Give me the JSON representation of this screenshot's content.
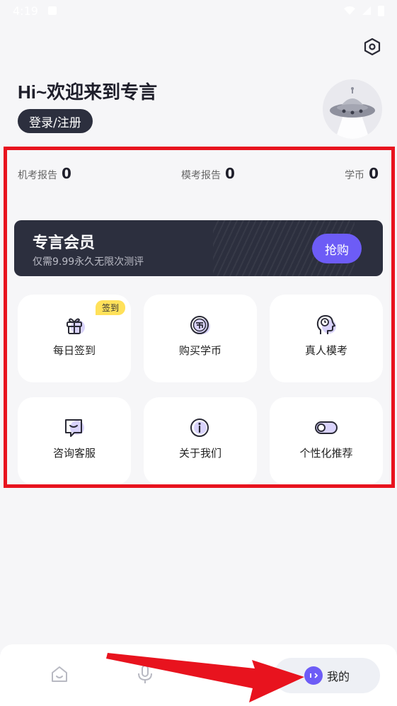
{
  "status_bar": {
    "time": "4:19"
  },
  "header": {
    "greeting": "Hi~欢迎来到专言",
    "login_label": "登录/注册"
  },
  "stats": [
    {
      "label": "机考报告",
      "value": "0"
    },
    {
      "label": "模考报告",
      "value": "0"
    },
    {
      "label": "学币",
      "value": "0"
    }
  ],
  "vip": {
    "title": "专言会员",
    "subtitle": "仅需9.99永久无限次测评",
    "button": "抢购"
  },
  "tiles": [
    {
      "label": "每日签到",
      "icon": "gift-icon",
      "badge": "签到"
    },
    {
      "label": "购买学币",
      "icon": "coin-icon"
    },
    {
      "label": "真人模考",
      "icon": "head-clock-icon"
    },
    {
      "label": "咨询客服",
      "icon": "chat-icon"
    },
    {
      "label": "关于我们",
      "icon": "info-icon"
    },
    {
      "label": "个性化推荐",
      "icon": "toggle-icon"
    }
  ],
  "bottom_nav": {
    "items": [
      {
        "icon": "home-icon"
      },
      {
        "icon": "microphone-icon"
      },
      {
        "icon": "bookmark-icon"
      }
    ],
    "active": {
      "icon": "profile-face-icon",
      "label": "我的"
    }
  },
  "colors": {
    "accent": "#6d5cf6",
    "dark_card": "#2c2f3e",
    "highlight": "#e8131e",
    "badge": "#ffe15a"
  }
}
